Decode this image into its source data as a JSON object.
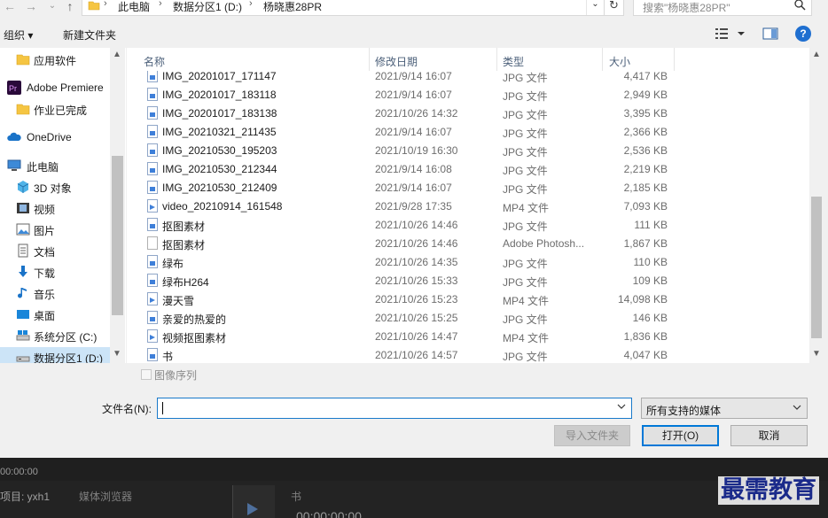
{
  "address": {
    "crumbs": [
      "此电脑",
      "数据分区1 (D:)",
      "杨晓惠28PR"
    ]
  },
  "search": {
    "placeholder": "搜索\"杨晓惠28PR\""
  },
  "toolbar": {
    "organize": "组织 ▾",
    "new_folder": "新建文件夹"
  },
  "nav": {
    "items": [
      {
        "label": "应用软件",
        "icon": "folder-icon"
      },
      {
        "label": "Adobe Premiere",
        "icon": "premiere-icon"
      },
      {
        "label": "作业已完成",
        "icon": "folder-icon"
      },
      {
        "label": "OneDrive",
        "icon": "onedrive-icon"
      },
      {
        "label": "此电脑",
        "icon": "computer-icon"
      },
      {
        "label": "3D 对象",
        "icon": "3d-objects-icon"
      },
      {
        "label": "视频",
        "icon": "video-icon"
      },
      {
        "label": "图片",
        "icon": "pictures-icon"
      },
      {
        "label": "文档",
        "icon": "documents-icon"
      },
      {
        "label": "下载",
        "icon": "downloads-icon"
      },
      {
        "label": "音乐",
        "icon": "music-icon"
      },
      {
        "label": "桌面",
        "icon": "desktop-icon"
      },
      {
        "label": "系统分区 (C:)",
        "icon": "drive-icon"
      },
      {
        "label": "数据分区1 (D:)",
        "icon": "drive-icon"
      }
    ]
  },
  "columns": {
    "name": "名称",
    "date": "修改日期",
    "type": "类型",
    "size": "大小"
  },
  "files": [
    {
      "name": "IMG_20201017_171147",
      "date": "2021/9/14 16:07",
      "type": "JPG 文件",
      "size": "4,417 KB",
      "kind": "jpg"
    },
    {
      "name": "IMG_20201017_183118",
      "date": "2021/9/14 16:07",
      "type": "JPG 文件",
      "size": "2,949 KB",
      "kind": "jpg"
    },
    {
      "name": "IMG_20201017_183138",
      "date": "2021/10/26 14:32",
      "type": "JPG 文件",
      "size": "3,395 KB",
      "kind": "jpg"
    },
    {
      "name": "IMG_20210321_211435",
      "date": "2021/9/14 16:07",
      "type": "JPG 文件",
      "size": "2,366 KB",
      "kind": "jpg"
    },
    {
      "name": "IMG_20210530_195203",
      "date": "2021/10/19 16:30",
      "type": "JPG 文件",
      "size": "2,536 KB",
      "kind": "jpg"
    },
    {
      "name": "IMG_20210530_212344",
      "date": "2021/9/14 16:08",
      "type": "JPG 文件",
      "size": "2,219 KB",
      "kind": "jpg"
    },
    {
      "name": "IMG_20210530_212409",
      "date": "2021/9/14 16:07",
      "type": "JPG 文件",
      "size": "2,185 KB",
      "kind": "jpg"
    },
    {
      "name": "video_20210914_161548",
      "date": "2021/9/28 17:35",
      "type": "MP4 文件",
      "size": "7,093 KB",
      "kind": "mp4"
    },
    {
      "name": "抠图素材",
      "date": "2021/10/26 14:46",
      "type": "JPG 文件",
      "size": "111 KB",
      "kind": "jpg"
    },
    {
      "name": "抠图素材",
      "date": "2021/10/26 14:46",
      "type": "Adobe Photosh...",
      "size": "1,867 KB",
      "kind": "psd"
    },
    {
      "name": "绿布",
      "date": "2021/10/26 14:35",
      "type": "JPG 文件",
      "size": "110 KB",
      "kind": "jpg"
    },
    {
      "name": "绿布H264",
      "date": "2021/10/26 15:33",
      "type": "JPG 文件",
      "size": "109 KB",
      "kind": "jpg"
    },
    {
      "name": "漫天雪",
      "date": "2021/10/26 15:23",
      "type": "MP4 文件",
      "size": "14,098 KB",
      "kind": "mp4"
    },
    {
      "name": "亲爱的热爱的",
      "date": "2021/10/26 15:25",
      "type": "JPG 文件",
      "size": "146 KB",
      "kind": "jpg"
    },
    {
      "name": "视频抠图素材",
      "date": "2021/10/26 14:47",
      "type": "MP4 文件",
      "size": "1,836 KB",
      "kind": "mp4"
    },
    {
      "name": "书",
      "date": "2021/10/26 14:57",
      "type": "JPG 文件",
      "size": "4,047 KB",
      "kind": "jpg"
    }
  ],
  "bottom": {
    "sequence_label": "图像序列",
    "filename_label": "文件名(N):",
    "filename_value": "",
    "filter": "所有支持的媒体",
    "import_folder": "导入文件夹",
    "open": "打开(O)",
    "cancel": "取消"
  },
  "background": {
    "timecode": "00:00:00",
    "project_tab": "项目: yxh1",
    "media_browser_tab": "媒体浏览器",
    "sequence_tab": "书",
    "timecode2": "00:00:00:00",
    "watermark": "最需教育"
  }
}
